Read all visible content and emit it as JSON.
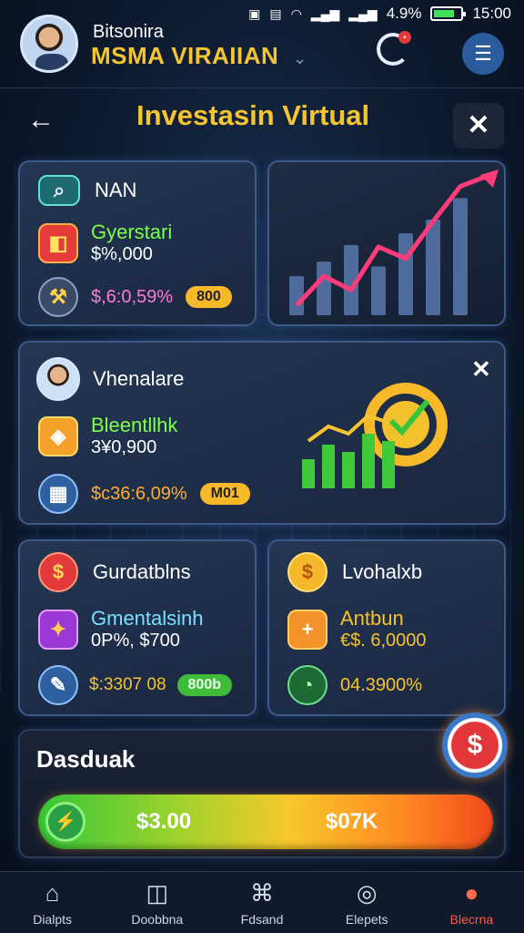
{
  "status_bar": {
    "battery": "4.9%",
    "time": "15:00"
  },
  "header": {
    "subtitle": "Bitsonira",
    "title": "MSMA VIRAIIAN"
  },
  "page": {
    "title": "Investasin Virtual"
  },
  "card_nan": {
    "title": "NAN",
    "item1_label": "Gyerstari",
    "item1_value": "$%,000",
    "value3": "$,6:0,59%",
    "pill": "800"
  },
  "card_vhenalare": {
    "title": "Vhenalare",
    "item1_label": "Bleentllhk",
    "item1_value": "3¥0,900",
    "value3": "$c36:6,09%",
    "pill": "M01"
  },
  "card_gurdatbins": {
    "title": "Gurdatblns",
    "item1_label": "Gmentalsinh",
    "item1_value": "0P%, $700",
    "value3": "$:3307 08",
    "pill": "800b"
  },
  "card_lvohalxb": {
    "title": "Lvohalxb",
    "item1_label": "Antbun",
    "item1_value": "€$. 6,0000",
    "value3": "04.3900%"
  },
  "dashboard": {
    "title": "Dasduak",
    "progress_left": "$3.00",
    "progress_right": "$07K",
    "progress_fraction": 1.0
  },
  "chart_top": {
    "bars": [
      40,
      55,
      72,
      50,
      84,
      98,
      120
    ],
    "line": [
      10,
      40,
      26,
      70,
      58,
      96,
      132
    ]
  },
  "chart_mid": {
    "bars": [
      32,
      48,
      40,
      60,
      52
    ]
  },
  "colors": {
    "accent": "#f5c531",
    "progress_start": "#36c63a",
    "progress_end": "#f04a1c"
  },
  "bottom_nav": [
    {
      "label": "Dialpts",
      "icon": "home-icon"
    },
    {
      "label": "Doobbna",
      "icon": "chart-icon"
    },
    {
      "label": "Fdsand",
      "icon": "building-icon"
    },
    {
      "label": "Elepets",
      "icon": "target-icon"
    },
    {
      "label": "Blecrna",
      "icon": "profile-icon"
    }
  ]
}
